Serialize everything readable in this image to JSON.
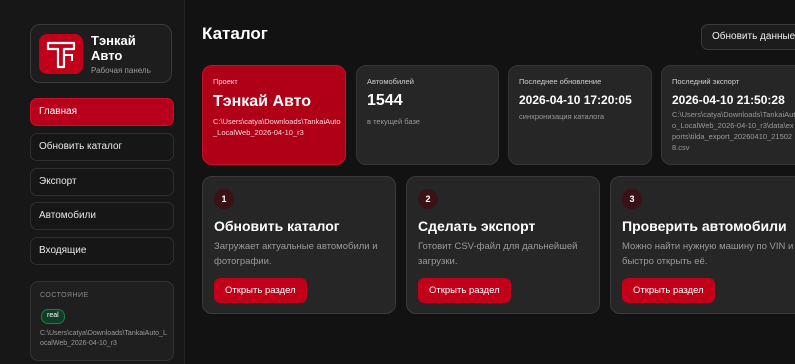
{
  "brand": {
    "title": "Тэнкай Авто",
    "subtitle": "Рабочая панель"
  },
  "nav": [
    {
      "label": "Главная"
    },
    {
      "label": "Обновить каталог"
    },
    {
      "label": "Экспорт"
    },
    {
      "label": "Автомобили"
    },
    {
      "label": "Входящие"
    }
  ],
  "status": {
    "label": "СОСТОЯНИЕ",
    "badge": "real",
    "path": "C:\\Users\\catya\\Downloads\\TankaiAuto_LocalWeb_2026-04-10_r3"
  },
  "header": {
    "title": "Каталог",
    "refresh_label": "Обновить данные"
  },
  "stats": {
    "project": {
      "label": "Проект",
      "value": "Тэнкай Авто",
      "sub": "C:\\Users\\catya\\Downloads\\TankaiAuto_LocalWeb_2026-04-10_r3"
    },
    "cars": {
      "label": "Автомобилей",
      "value": "1544",
      "sub": "в текущей базе"
    },
    "last_update": {
      "label": "Последнее обновление",
      "value": "2026-04-10 17:20:05",
      "sub": "синхронизация каталога"
    },
    "last_export": {
      "label": "Последний экспорт",
      "value": "2026-04-10 21:50:28",
      "sub": "C:\\Users\\catya\\Downloads\\TankaiAuto_LocalWeb_2026-04-10_r3\\data\\exports\\tilda_export_20260410_215028.csv"
    }
  },
  "steps": [
    {
      "num": "1",
      "title": "Обновить каталог",
      "desc": "Загружает актуальные автомобили и фотографии.",
      "button": "Открыть раздел"
    },
    {
      "num": "2",
      "title": "Сделать экспорт",
      "desc": "Готовит CSV-файл для дальнейшей загрузки.",
      "button": "Открыть раздел"
    },
    {
      "num": "3",
      "title": "Проверить автомобили",
      "desc": "Можно найти нужную машину по VIN и быстро открыть её.",
      "button": "Открыть раздел"
    }
  ],
  "colors": {
    "accent": "#c2001a",
    "background": "#121212",
    "card": "#262626"
  }
}
